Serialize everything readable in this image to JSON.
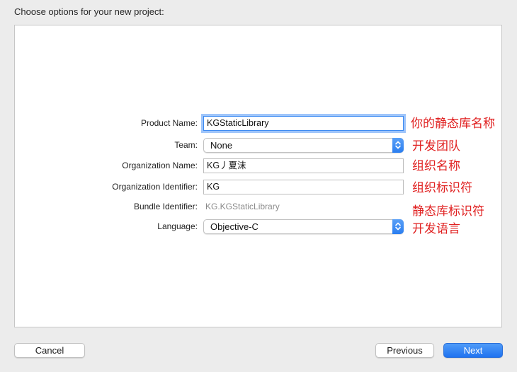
{
  "header": {
    "title": "Choose options for your new project:"
  },
  "form": {
    "product_name": {
      "label": "Product Name:",
      "value": "KGStaticLibrary",
      "annotation": "你的静态库名称"
    },
    "team": {
      "label": "Team:",
      "value": "None",
      "annotation": "开发团队"
    },
    "organization_name": {
      "label": "Organization Name:",
      "value": "KG丿夏沫",
      "annotation": "组织名称"
    },
    "organization_identifier": {
      "label": "Organization Identifier:",
      "value": "KG",
      "annotation": "组织标识符"
    },
    "bundle_identifier": {
      "label": "Bundle Identifier:",
      "value": "KG.KGStaticLibrary",
      "annotation": "静态库标识符"
    },
    "language": {
      "label": "Language:",
      "value": "Objective-C",
      "annotation": "开发语言"
    }
  },
  "footer": {
    "cancel_label": "Cancel",
    "previous_label": "Previous",
    "next_label": "Next"
  },
  "colors": {
    "accent": "#1f73f0",
    "annotation": "#e02020",
    "focus_ring": "#3d8bf2"
  },
  "icons": {
    "popup_arrows": "chevron-up-down-icon"
  }
}
